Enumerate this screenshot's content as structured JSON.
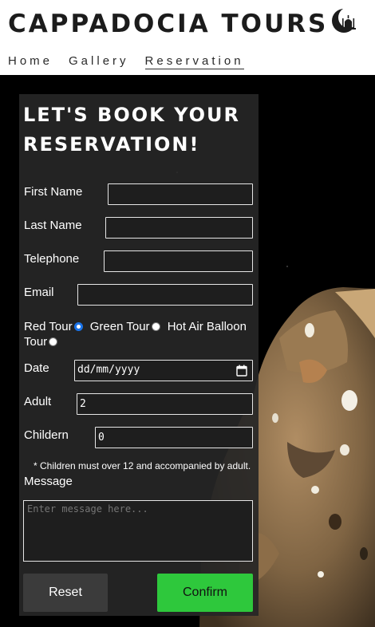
{
  "header": {
    "title": "CAPPADOCIA TOURS",
    "logo_icon": "crescent-mosque-icon",
    "nav": [
      {
        "label": "Home",
        "active": false
      },
      {
        "label": "Gallery",
        "active": false
      },
      {
        "label": "Reservation",
        "active": true
      }
    ]
  },
  "form": {
    "title": "LET'S BOOK YOUR RESERVATION!",
    "first_name": {
      "label": "First Name",
      "value": ""
    },
    "last_name": {
      "label": "Last Name",
      "value": ""
    },
    "telephone": {
      "label": "Telephone",
      "value": ""
    },
    "email": {
      "label": "Email",
      "value": ""
    },
    "tours": [
      {
        "label": "Red Tour",
        "checked": true
      },
      {
        "label": "Green Tour",
        "checked": false
      },
      {
        "label": "Hot Air Balloon Tour",
        "checked": false
      }
    ],
    "date": {
      "label": "Date",
      "placeholder": "dd/mm/yyyy",
      "icon": "calendar-icon"
    },
    "adult": {
      "label": "Adult",
      "value": "2"
    },
    "children": {
      "label": "Childern",
      "value": "0"
    },
    "note": "* Children must over 12 and accompanied by adult.",
    "message": {
      "label": "Message",
      "placeholder": "Enter message here..."
    },
    "reset_label": "Reset",
    "confirm_label": "Confirm"
  },
  "colors": {
    "card_bg": "#262626",
    "confirm": "#2ec83c",
    "radio_checked": "#1a73e8"
  }
}
